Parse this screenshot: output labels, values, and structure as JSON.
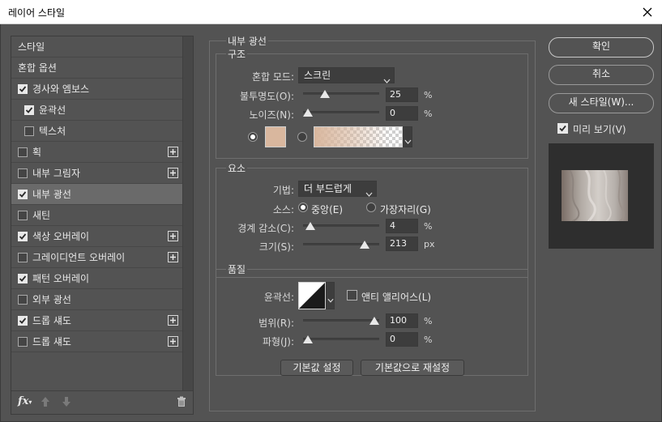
{
  "window": {
    "title": "레이어 스타일"
  },
  "sidebar": {
    "items": [
      {
        "label": "스타일",
        "checkbox": null,
        "plus": false
      },
      {
        "label": "혼합 옵션",
        "checkbox": null,
        "plus": false
      },
      {
        "label": "경사와 엠보스",
        "checkbox": true,
        "plus": false
      },
      {
        "label": "윤곽선",
        "checkbox": true,
        "plus": false,
        "sub": true
      },
      {
        "label": "텍스처",
        "checkbox": false,
        "plus": false,
        "sub": true
      },
      {
        "label": "획",
        "checkbox": false,
        "plus": true
      },
      {
        "label": "내부 그림자",
        "checkbox": false,
        "plus": true
      },
      {
        "label": "내부 광선",
        "checkbox": true,
        "plus": false,
        "selected": true
      },
      {
        "label": "새틴",
        "checkbox": false,
        "plus": false
      },
      {
        "label": "색상 오버레이",
        "checkbox": true,
        "plus": true
      },
      {
        "label": "그레이디언트 오버레이",
        "checkbox": false,
        "plus": true
      },
      {
        "label": "패턴 오버레이",
        "checkbox": true,
        "plus": false
      },
      {
        "label": "외부 광선",
        "checkbox": false,
        "plus": false
      },
      {
        "label": "드롭 섀도",
        "checkbox": true,
        "plus": true
      },
      {
        "label": "드롭 섀도",
        "checkbox": false,
        "plus": true
      }
    ],
    "footer": {
      "fx_label": "fx"
    }
  },
  "main": {
    "section_title": "내부 광선",
    "structure": {
      "title": "구조",
      "blend_mode_label": "혼합 모드:",
      "blend_mode_value": "스크린",
      "opacity_label": "불투명도(O):",
      "opacity_value": "25",
      "noise_label": "노이즈(N):",
      "noise_value": "0",
      "percent": "%"
    },
    "elements": {
      "title": "요소",
      "technique_label": "기법:",
      "technique_value": "더 부드럽게",
      "source_label": "소스:",
      "source_center": "중앙(E)",
      "source_edge": "가장자리(G)",
      "choke_label": "경계 감소(C):",
      "choke_value": "4",
      "size_label": "크기(S):",
      "size_value": "213",
      "percent": "%",
      "px": "px"
    },
    "quality": {
      "title": "품질",
      "contour_label": "윤곽선:",
      "antialias_label": "앤티 앨리어스(L)",
      "range_label": "범위(R):",
      "range_value": "100",
      "jitter_label": "파형(J):",
      "jitter_value": "0",
      "percent": "%"
    },
    "set_default_label": "기본값 설정",
    "reset_default_label": "기본값으로 재설정"
  },
  "right": {
    "ok_label": "확인",
    "cancel_label": "취소",
    "new_style_label": "새 스타일(W)...",
    "preview_label": "미리 보기(V)",
    "preview_checked": true
  },
  "sliders": {
    "opacity": 0.25,
    "noise": 0.0,
    "choke": 0.04,
    "size": 0.852,
    "range": 1.0,
    "jitter": 0.0
  },
  "colors": {
    "glow_swatch": "#d9b79e",
    "panel_bg": "#535353",
    "selected_item": "#6a6a6a"
  }
}
